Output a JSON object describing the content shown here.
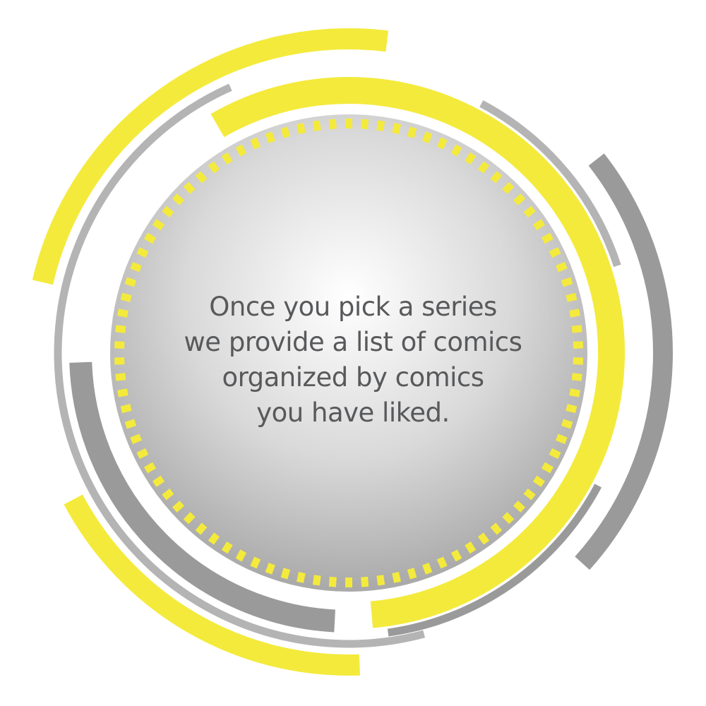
{
  "caption": {
    "lines": [
      "Once you pick a series",
      "we provide a list of comics",
      "organized by comics",
      "you have liked."
    ]
  },
  "colors": {
    "yellow": "#f4ea3c",
    "gray": "#9a9a9a",
    "gray_light": "#b4b4b4",
    "text": "#58595b"
  }
}
